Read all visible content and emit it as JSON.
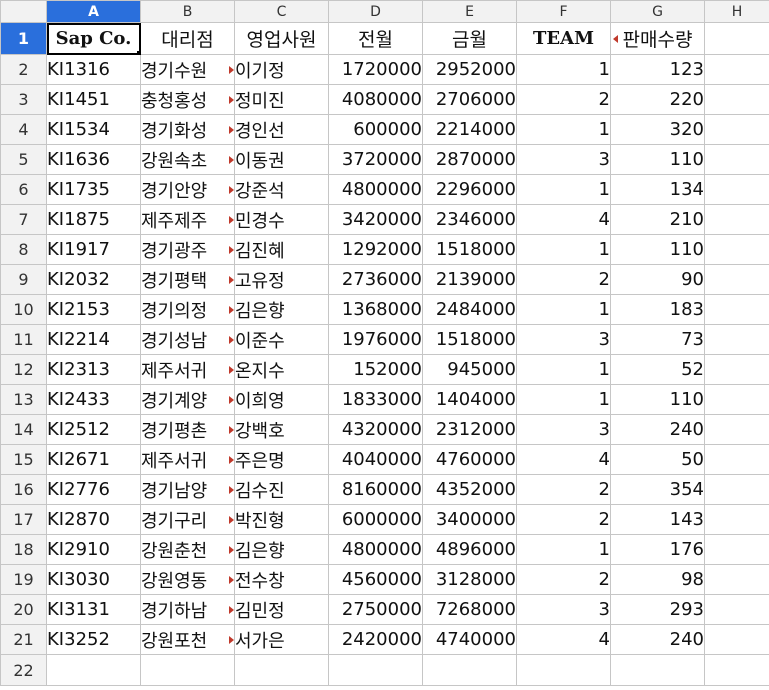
{
  "spreadsheet": {
    "column_letters": [
      "A",
      "B",
      "C",
      "D",
      "E",
      "F",
      "G",
      "H"
    ],
    "row_numbers": [
      "1",
      "2",
      "3",
      "4",
      "5",
      "6",
      "7",
      "8",
      "9",
      "10",
      "11",
      "12",
      "13",
      "14",
      "15",
      "16",
      "17",
      "18",
      "19",
      "20",
      "21",
      "22"
    ],
    "selected_column": "A",
    "selected_row": "1",
    "headers": {
      "sap_co": "Sap Co.",
      "dealer": "대리점",
      "sales_rep": "영업사원",
      "prev_month": "전월",
      "this_month": "금월",
      "team": "TEAM",
      "qty": "판매수량"
    },
    "rows": [
      {
        "sap": "KI1316",
        "dealer": "경기수원",
        "rep": "이기정",
        "prev": "1720000",
        "cur": "2952000",
        "team": "1",
        "qty": "123"
      },
      {
        "sap": "KI1451",
        "dealer": "충청홍성",
        "rep": "정미진",
        "prev": "4080000",
        "cur": "2706000",
        "team": "2",
        "qty": "220"
      },
      {
        "sap": "KI1534",
        "dealer": "경기화성",
        "rep": "경인선",
        "prev": "600000",
        "cur": "2214000",
        "team": "1",
        "qty": "320"
      },
      {
        "sap": "KI1636",
        "dealer": "강원속초",
        "rep": "이동권",
        "prev": "3720000",
        "cur": "2870000",
        "team": "3",
        "qty": "110"
      },
      {
        "sap": "KI1735",
        "dealer": "경기안양",
        "rep": "강준석",
        "prev": "4800000",
        "cur": "2296000",
        "team": "1",
        "qty": "134"
      },
      {
        "sap": "KI1875",
        "dealer": "제주제주",
        "rep": "민경수",
        "prev": "3420000",
        "cur": "2346000",
        "team": "4",
        "qty": "210"
      },
      {
        "sap": "KI1917",
        "dealer": "경기광주",
        "rep": "김진혜",
        "prev": "1292000",
        "cur": "1518000",
        "team": "1",
        "qty": "110"
      },
      {
        "sap": "KI2032",
        "dealer": "경기평택",
        "rep": "고유정",
        "prev": "2736000",
        "cur": "2139000",
        "team": "2",
        "qty": "90"
      },
      {
        "sap": "KI2153",
        "dealer": "경기의정",
        "rep": "김은향",
        "prev": "1368000",
        "cur": "2484000",
        "team": "1",
        "qty": "183"
      },
      {
        "sap": "KI2214",
        "dealer": "경기성남",
        "rep": "이준수",
        "prev": "1976000",
        "cur": "1518000",
        "team": "3",
        "qty": "73"
      },
      {
        "sap": "KI2313",
        "dealer": "제주서귀",
        "rep": "온지수",
        "prev": "152000",
        "cur": "945000",
        "team": "1",
        "qty": "52"
      },
      {
        "sap": "KI2433",
        "dealer": "경기계양",
        "rep": "이희영",
        "prev": "1833000",
        "cur": "1404000",
        "team": "1",
        "qty": "110"
      },
      {
        "sap": "KI2512",
        "dealer": "경기평촌",
        "rep": "강백호",
        "prev": "4320000",
        "cur": "2312000",
        "team": "3",
        "qty": "240"
      },
      {
        "sap": "KI2671",
        "dealer": "제주서귀",
        "rep": "주은명",
        "prev": "4040000",
        "cur": "4760000",
        "team": "4",
        "qty": "50"
      },
      {
        "sap": "KI2776",
        "dealer": "경기남양",
        "rep": "김수진",
        "prev": "8160000",
        "cur": "4352000",
        "team": "2",
        "qty": "354"
      },
      {
        "sap": "KI2870",
        "dealer": "경기구리",
        "rep": "박진형",
        "prev": "6000000",
        "cur": "3400000",
        "team": "2",
        "qty": "143"
      },
      {
        "sap": "KI2910",
        "dealer": "강원춘천",
        "rep": "김은향",
        "prev": "4800000",
        "cur": "4896000",
        "team": "1",
        "qty": "176"
      },
      {
        "sap": "KI3030",
        "dealer": "강원영동",
        "rep": "전수창",
        "prev": "4560000",
        "cur": "3128000",
        "team": "2",
        "qty": "98"
      },
      {
        "sap": "KI3131",
        "dealer": "경기하남",
        "rep": "김민정",
        "prev": "2750000",
        "cur": "7268000",
        "team": "3",
        "qty": "293"
      },
      {
        "sap": "KI3252",
        "dealer": "강원포천",
        "rep": "서가은",
        "prev": "2420000",
        "cur": "4740000",
        "team": "4",
        "qty": "240"
      }
    ],
    "colors": {
      "selection": "#2a6fdc",
      "header_bg": "#f2f2f2",
      "gridline": "#c6c6c6",
      "overflow_marker": "#c0392b"
    }
  }
}
